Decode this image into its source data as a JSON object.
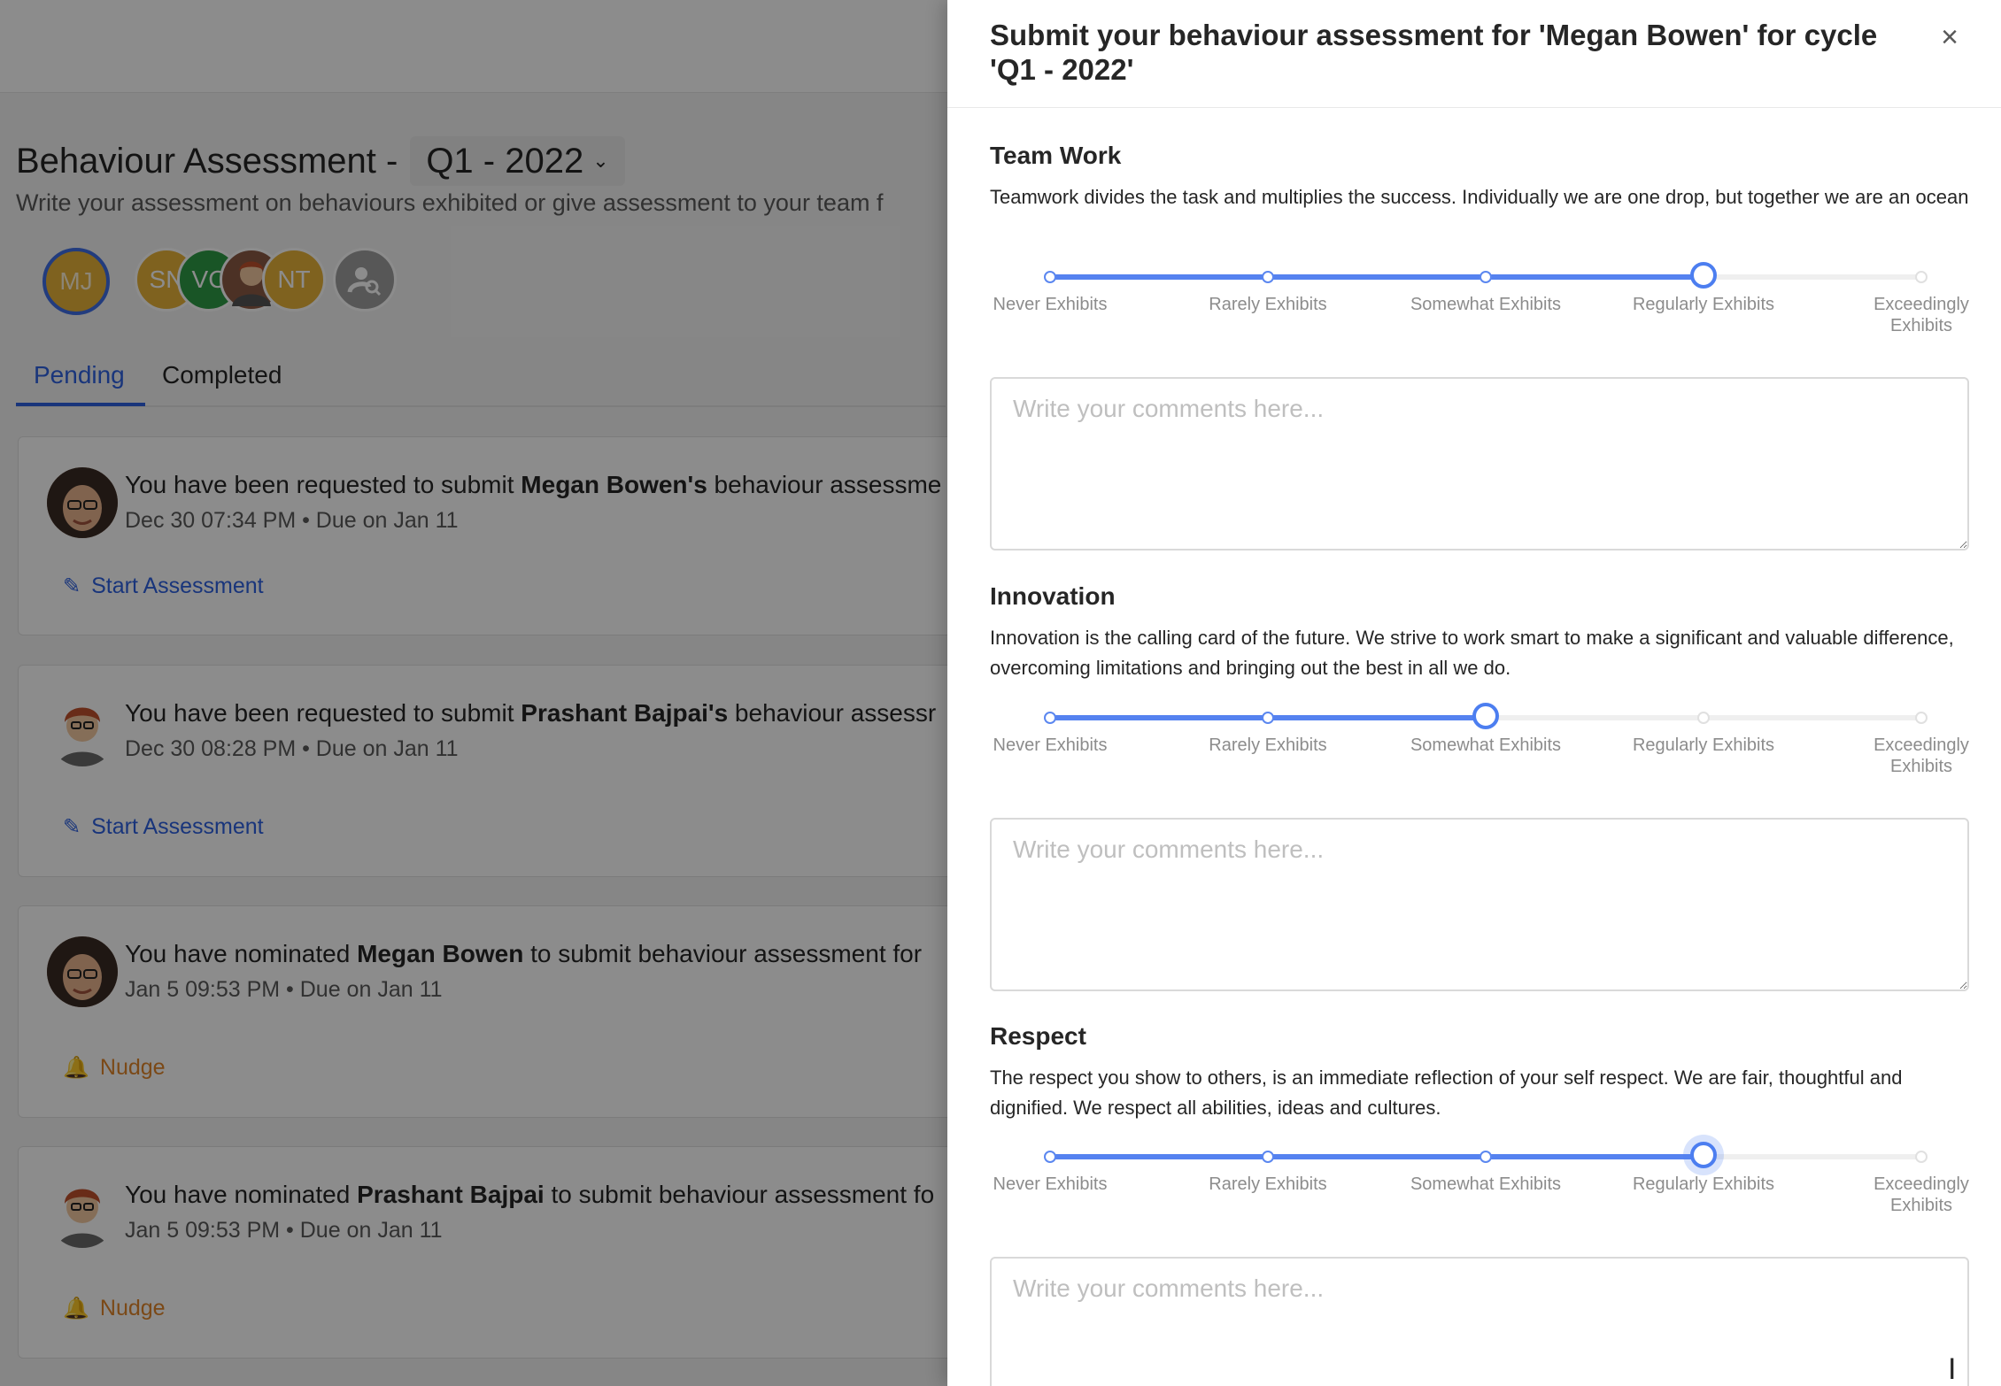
{
  "background": {
    "page_title": "Behaviour Assessment -",
    "cycle": "Q1 - 2022",
    "subtitle": "Write your assessment on behaviours exhibited or give assessment to your team f",
    "avatars": [
      "MJ",
      "SN",
      "VC",
      "NT"
    ],
    "tabs": [
      {
        "label": "Pending",
        "active": true
      },
      {
        "label": "Completed",
        "active": false
      }
    ],
    "cards": [
      {
        "prefix": "You have been requested to submit ",
        "name": "Megan Bowen's",
        "suffix": " behaviour assessme",
        "meta": "Dec 30 07:34 PM • Due on Jan 11",
        "action": "Start Assessment",
        "action_icon": "pencil-icon"
      },
      {
        "prefix": "You have been requested to submit ",
        "name": "Prashant Bajpai's",
        "suffix": " behaviour assessr",
        "meta": "Dec 30 08:28 PM • Due on Jan 11",
        "action": "Start Assessment",
        "action_icon": "pencil-icon"
      },
      {
        "prefix": "You have nominated ",
        "name": "Megan Bowen",
        "suffix": " to submit behaviour assessment for",
        "meta": "Jan 5 09:53 PM • Due on Jan 11",
        "action": "Nudge",
        "action_icon": "bell-icon"
      },
      {
        "prefix": "You have nominated ",
        "name": "Prashant Bajpai",
        "suffix": " to submit behaviour assessment fo",
        "meta": "Jan 5 09:53 PM • Due on Jan 11",
        "action": "Nudge",
        "action_icon": "bell-icon"
      }
    ]
  },
  "drawer": {
    "title": "Submit your behaviour assessment for 'Megan Bowen' for cycle 'Q1 - 2022'",
    "close_icon": "×",
    "scale_labels": [
      "Never Exhibits",
      "Rarely Exhibits",
      "Somewhat Exhibits",
      "Regularly Exhibits",
      "Exceedingly Exhibits"
    ],
    "comment_placeholder": "Write your comments here...",
    "sections": [
      {
        "title": "Team Work",
        "description": "Teamwork divides the task and multiplies the success. Individually we are one drop, but together we are an ocean",
        "selected_index": 3
      },
      {
        "title": "Innovation",
        "description": "Innovation is the calling card of the future. We strive to work smart to make a significant and valuable difference, overcoming limitations and bringing out the best in all we do.",
        "selected_index": 2
      },
      {
        "title": "Respect",
        "description": "The respect you show to others, is an immediate reflection of your self respect. We are fair, thoughtful and dignified. We respect all abilities, ideas and cultures.",
        "selected_index": 3
      }
    ]
  },
  "colors": {
    "accent": "#2f62e0",
    "slider": "#5582f0",
    "nudge": "#e0852a"
  }
}
